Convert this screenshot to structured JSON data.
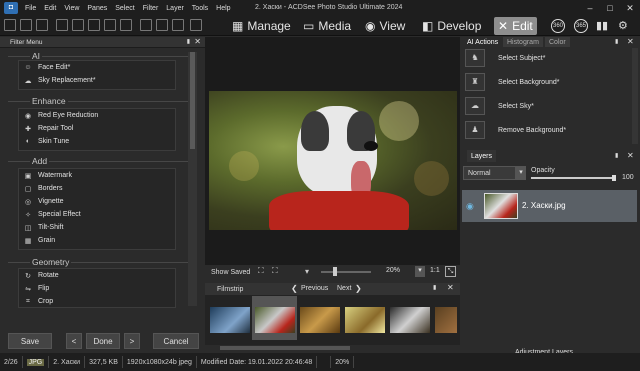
{
  "app": {
    "title": "2. Хаски - ACDSee Photo Studio Ultimate 2024"
  },
  "menu": [
    "File",
    "Edit",
    "View",
    "Panes",
    "Select",
    "Filter",
    "Layer",
    "Tools",
    "Help"
  ],
  "modes": [
    {
      "label": "Manage",
      "icon": "grid-icon"
    },
    {
      "label": "Media",
      "icon": "media-icon"
    },
    {
      "label": "View",
      "icon": "eye-icon"
    },
    {
      "label": "Develop",
      "icon": "develop-icon"
    },
    {
      "label": "Edit",
      "icon": "edit-icon",
      "active": true
    }
  ],
  "mode_circles": [
    "360",
    "365"
  ],
  "filter_menu": {
    "title": "Filter Menu",
    "categories": [
      {
        "name": "AI",
        "items": [
          {
            "label": "Face Edit*",
            "icon": "face-icon"
          },
          {
            "label": "Sky Replacement*",
            "icon": "sky-icon"
          }
        ]
      },
      {
        "name": "Enhance",
        "items": [
          {
            "label": "Red Eye Reduction",
            "icon": "eye-icon"
          },
          {
            "label": "Repair Tool",
            "icon": "bandage-icon"
          },
          {
            "label": "Skin Tune",
            "icon": "skin-icon"
          }
        ]
      },
      {
        "name": "Add",
        "items": [
          {
            "label": "Watermark",
            "icon": "watermark-icon"
          },
          {
            "label": "Borders",
            "icon": "borders-icon"
          },
          {
            "label": "Vignette",
            "icon": "vignette-icon"
          },
          {
            "label": "Special Effect",
            "icon": "sparkle-icon"
          },
          {
            "label": "Tilt-Shift",
            "icon": "tilt-icon"
          },
          {
            "label": "Grain",
            "icon": "grain-icon"
          }
        ]
      },
      {
        "name": "Geometry",
        "items": [
          {
            "label": "Rotate",
            "icon": "rotate-icon"
          },
          {
            "label": "Flip",
            "icon": "flip-icon"
          },
          {
            "label": "Crop",
            "icon": "crop-icon"
          }
        ]
      }
    ]
  },
  "buttons": {
    "save": "Save",
    "done": "Done",
    "cancel": "Cancel",
    "prev_arrow": "<",
    "next_arrow": ">"
  },
  "viewer": {
    "show_saved": "Show Saved",
    "zoom": "20%",
    "ratio": "1:1"
  },
  "filmstrip": {
    "title": "Filmstrip",
    "previous": "Previous",
    "next": "Next"
  },
  "right": {
    "tabs": [
      "AI Actions",
      "Histogram",
      "Color"
    ],
    "ai_actions": [
      "Select Subject*",
      "Select Background*",
      "Select Sky*",
      "Remove Background*"
    ],
    "layers": {
      "tab": "Layers",
      "blend": "Normal",
      "opacity_label": "Opacity",
      "opacity_value": "100",
      "opacity_fraction": 1.0,
      "layer_name": "2. Хаски.jpg",
      "adjustment": "Adjustment Layers"
    }
  },
  "status": {
    "index": "2/26",
    "format": "JPG",
    "name": "2. Хаски",
    "size": "327,5 KB",
    "dims": "1920x1080x24b jpeg",
    "modified": "Modified Date: 19.01.2022 20:46:48",
    "zoom": "20%"
  },
  "colors": {
    "accent": "#8e8e8e",
    "layer_bg": "#5a6066"
  }
}
